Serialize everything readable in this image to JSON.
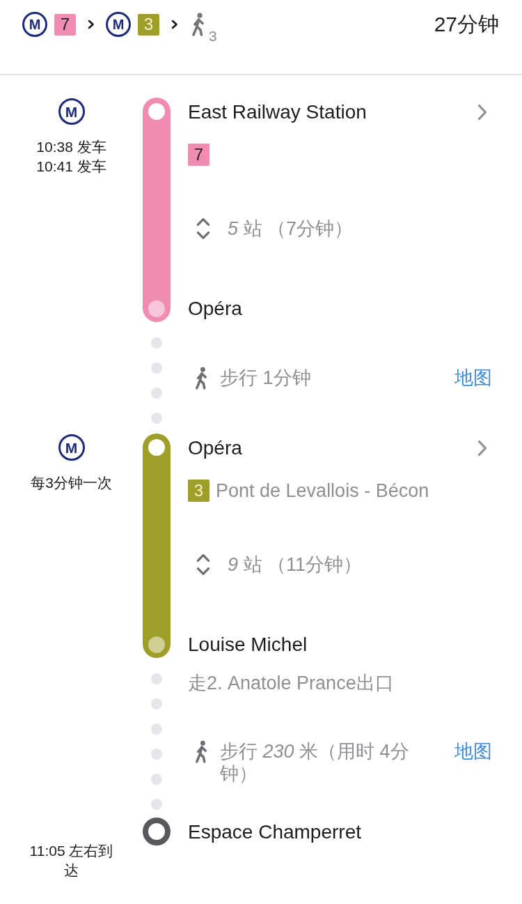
{
  "summary": {
    "legs": [
      {
        "kind": "metro",
        "logo": "M",
        "line": "7",
        "color": "#f08cb2"
      },
      {
        "kind": "metro",
        "logo": "M",
        "line": "3",
        "color": "#9e9e28"
      },
      {
        "kind": "walk",
        "count": "3"
      }
    ],
    "duration": "27分钟"
  },
  "itinerary": [
    {
      "kind": "transit",
      "logo": "M",
      "schedule": [
        "10:38 发车",
        "10:41 发车"
      ],
      "from": "East Railway Station",
      "line": "7",
      "color": "#f08cb2",
      "stops": "*5* 站 （7分钟）",
      "to": "Opéra"
    },
    {
      "kind": "walk",
      "text": "步行 1分钟",
      "link": "地图"
    },
    {
      "kind": "transit",
      "logo": "M",
      "schedule": [
        "每3分钟一次"
      ],
      "from": "Opéra",
      "line": "3",
      "color": "#9e9e28",
      "direction": "Pont de Levallois - Bécon",
      "stops": "*9* 站 （11分钟）",
      "to": "Louise Michel"
    },
    {
      "kind": "walk",
      "note": "走2. Anatole Prance出口",
      "text": "步行 *230* 米（用时 4分钟）",
      "link": "地图"
    },
    {
      "kind": "destination",
      "arrival": "11:05 左右到达",
      "name": "Espace Champerret"
    }
  ]
}
